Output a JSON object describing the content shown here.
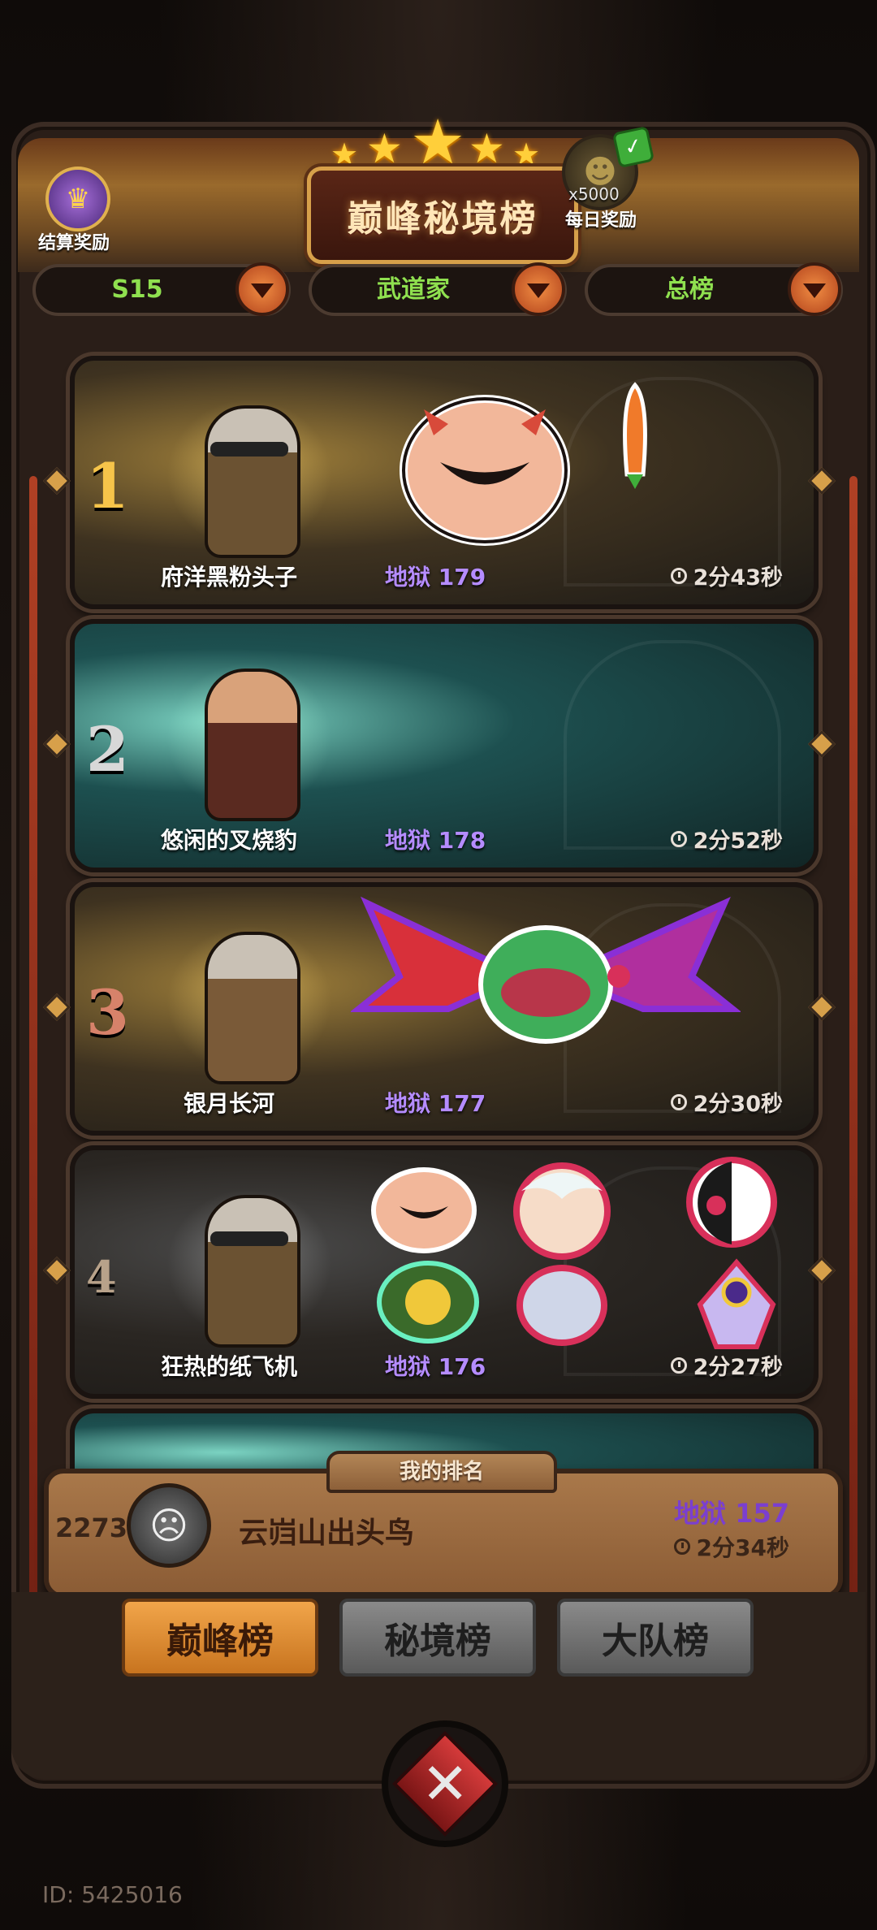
{
  "header": {
    "title": "巅峰秘境榜",
    "settle_reward_label": "结算奖励",
    "daily_reward_label": "每日奖励",
    "daily_reward_count": "x5000"
  },
  "filters": [
    {
      "label": "S15"
    },
    {
      "label": "武道家"
    },
    {
      "label": "总榜"
    }
  ],
  "rankings": [
    {
      "rank": "1",
      "name": "府洋黑粉头子",
      "level": "地狱 179",
      "time": "2分43秒"
    },
    {
      "rank": "2",
      "name": "悠闲的叉烧豹",
      "level": "地狱 178",
      "time": "2分52秒"
    },
    {
      "rank": "3",
      "name": "银月长河",
      "level": "地狱 177",
      "time": "2分30秒"
    },
    {
      "rank": "4",
      "name": "狂热的纸飞机",
      "level": "地狱 176",
      "time": "2分27秒"
    }
  ],
  "my_rank": {
    "title": "我的排名",
    "rank": "2273",
    "name": "云岿山出头鸟",
    "level": "地狱 157",
    "time": "2分34秒"
  },
  "tabs": [
    {
      "label": "巅峰榜",
      "active": true
    },
    {
      "label": "秘境榜",
      "active": false
    },
    {
      "label": "大队榜",
      "active": false
    }
  ],
  "user_id": "ID: 5425016",
  "colors": {
    "accent_gold": "#d7a04a",
    "level_purple": "#b58cff",
    "filter_green": "#8fe04f",
    "active_tab": "#f1a54a"
  }
}
